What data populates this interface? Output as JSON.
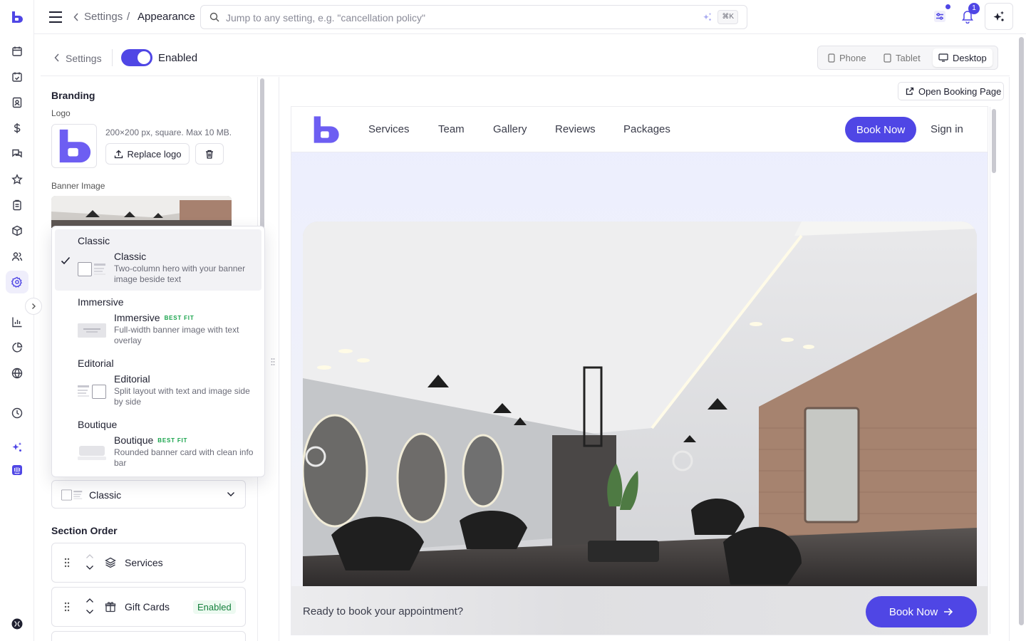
{
  "topbar": {
    "back_label": "Settings",
    "separator": "/",
    "current_page": "Appearance",
    "search_placeholder": "Jump to any setting, e.g. \"cancellation policy\"",
    "shortcut": "⌘K",
    "notification_count": "1"
  },
  "subbar": {
    "back_label": "Settings",
    "toggle_label": "Enabled",
    "devices": [
      "Phone",
      "Tablet",
      "Desktop"
    ],
    "active_device": "Desktop"
  },
  "branding": {
    "title": "Branding",
    "logo_label": "Logo",
    "logo_hint": "200×200 px, square. Max 10 MB.",
    "replace_label": "Replace logo",
    "banner_label": "Banner Image"
  },
  "layout_dropdown": {
    "options": [
      {
        "group": "Classic",
        "title": "Classic",
        "badge": "",
        "desc": "Two-column hero with your banner image beside text",
        "selected": true
      },
      {
        "group": "Immersive",
        "title": "Immersive",
        "badge": "BEST FIT",
        "desc": "Full-width banner image with text overlay",
        "selected": false
      },
      {
        "group": "Editorial",
        "title": "Editorial",
        "badge": "",
        "desc": "Split layout with text and image side by side",
        "selected": false
      },
      {
        "group": "Boutique",
        "title": "Boutique",
        "badge": "BEST FIT",
        "desc": "Rounded banner card with clean info bar",
        "selected": false
      }
    ],
    "selected_value": "Classic"
  },
  "section_order": {
    "title": "Section Order",
    "items": [
      {
        "label": "Services",
        "badge": ""
      },
      {
        "label": "Gift Cards",
        "badge": "Enabled"
      }
    ]
  },
  "preview": {
    "open_label": "Open Booking Page",
    "nav_links": [
      "Services",
      "Team",
      "Gallery",
      "Reviews",
      "Packages"
    ],
    "book_label": "Book Now",
    "signin_label": "Sign in",
    "cta_text": "Ready to book your appointment?",
    "cta_button": "Book Now"
  },
  "colors": {
    "accent": "#4f46e5",
    "success": "#16a34a"
  }
}
